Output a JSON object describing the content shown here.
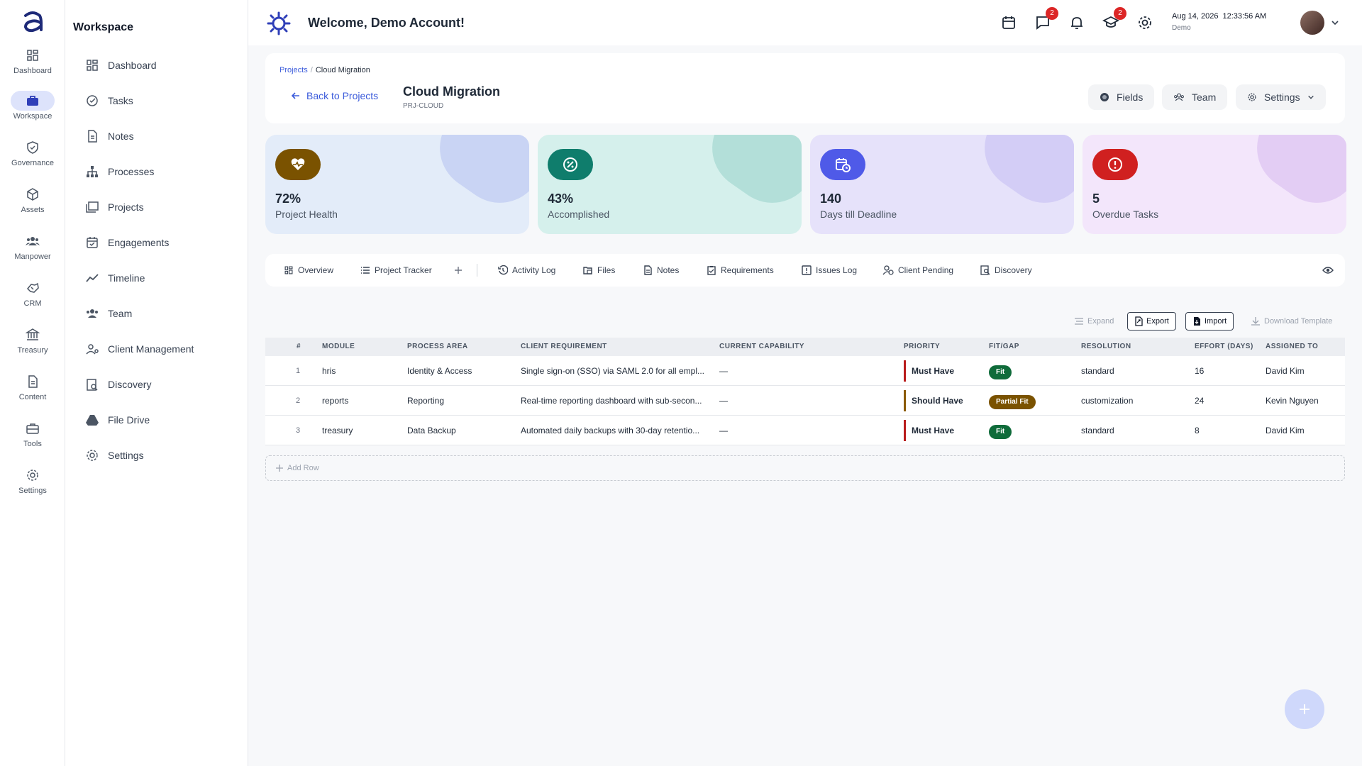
{
  "rail": {
    "items": [
      {
        "label": "Dashboard",
        "icon": "grid-icon"
      },
      {
        "label": "Workspace",
        "icon": "briefcase-icon"
      },
      {
        "label": "Governance",
        "icon": "shield-icon"
      },
      {
        "label": "Assets",
        "icon": "cube-icon"
      },
      {
        "label": "Manpower",
        "icon": "people-icon"
      },
      {
        "label": "CRM",
        "icon": "handshake-icon"
      },
      {
        "label": "Treasury",
        "icon": "bank-icon"
      },
      {
        "label": "Content",
        "icon": "document-icon"
      },
      {
        "label": "Tools",
        "icon": "toolbox-icon"
      },
      {
        "label": "Settings",
        "icon": "gear-icon"
      }
    ],
    "active": "Workspace"
  },
  "sidebar": {
    "title": "Workspace",
    "items": [
      {
        "label": "Dashboard"
      },
      {
        "label": "Tasks"
      },
      {
        "label": "Notes"
      },
      {
        "label": "Processes"
      },
      {
        "label": "Projects"
      },
      {
        "label": "Engagements"
      },
      {
        "label": "Timeline"
      },
      {
        "label": "Team"
      },
      {
        "label": "Client Management"
      },
      {
        "label": "Discovery"
      },
      {
        "label": "File Drive"
      },
      {
        "label": "Settings"
      }
    ]
  },
  "topbar": {
    "welcome": "Welcome, Demo Account!",
    "messages_badge": "2",
    "learning_badge": "2",
    "date": "Aug 14, 2026",
    "time": "12:33:56 AM",
    "user": "Demo"
  },
  "header": {
    "breadcrumb_parent": "Projects",
    "breadcrumb_separator": "/",
    "breadcrumb_current": "Cloud Migration",
    "back_label": "Back to Projects",
    "title": "Cloud Migration",
    "code": "PRJ-CLOUD",
    "fields_label": "Fields",
    "team_label": "Team",
    "settings_label": "Settings"
  },
  "stats": [
    {
      "value": "72%",
      "label": "Project Health",
      "icon": "heart-pulse-icon",
      "bg": "#e3ecf9",
      "accent": "#7a5200",
      "blob": "#c9d4f4"
    },
    {
      "value": "43%",
      "label": "Accomplished",
      "icon": "percent-icon",
      "bg": "#d5f0ec",
      "accent": "#0f7d6c",
      "blob": "#b3dfd9"
    },
    {
      "value": "140",
      "label": "Days till Deadline",
      "icon": "calendar-clock-icon",
      "bg": "#e6e2fa",
      "accent": "#4f5ae8",
      "blob": "#d3cdf6"
    },
    {
      "value": "5",
      "label": "Overdue Tasks",
      "icon": "alert-circle-icon",
      "bg": "#f3e6fb",
      "accent": "#d02020",
      "blob": "#e3cdf4"
    }
  ],
  "tabs": [
    {
      "label": "Overview"
    },
    {
      "label": "Project Tracker"
    },
    {
      "label": "Activity Log"
    },
    {
      "label": "Files"
    },
    {
      "label": "Notes"
    },
    {
      "label": "Requirements"
    },
    {
      "label": "Issues Log"
    },
    {
      "label": "Client Pending"
    },
    {
      "label": "Discovery"
    }
  ],
  "toolbar": {
    "expand": "Expand",
    "export": "Export",
    "import": "Import",
    "download_template": "Download Template"
  },
  "table": {
    "columns": [
      "#",
      "MODULE",
      "PROCESS AREA",
      "CLIENT REQUIREMENT",
      "CURRENT CAPABILITY",
      "PRIORITY",
      "FIT/GAP",
      "RESOLUTION",
      "EFFORT (DAYS)",
      "ASSIGNED TO"
    ],
    "rows": [
      {
        "num": "1",
        "module": "hris",
        "area": "Identity & Access",
        "requirement": "Single sign-on (SSO) via SAML 2.0 for all empl...",
        "capability": "—",
        "priority": "Must Have",
        "fit": "Fit",
        "resolution": "standard",
        "effort": "16",
        "assigned": "David Kim"
      },
      {
        "num": "2",
        "module": "reports",
        "area": "Reporting",
        "requirement": "Real-time reporting dashboard with sub-secon...",
        "capability": "—",
        "priority": "Should Have",
        "fit": "Partial Fit",
        "resolution": "customization",
        "effort": "24",
        "assigned": "Kevin Nguyen"
      },
      {
        "num": "3",
        "module": "treasury",
        "area": "Data Backup",
        "requirement": "Automated daily backups with 30-day retentio...",
        "capability": "—",
        "priority": "Must Have",
        "fit": "Fit",
        "resolution": "standard",
        "effort": "8",
        "assigned": "David Kim"
      }
    ],
    "add_row": "Add Row"
  },
  "colors": {
    "brand": "#3b5bdb",
    "accent_soft": "#dde3fb"
  }
}
